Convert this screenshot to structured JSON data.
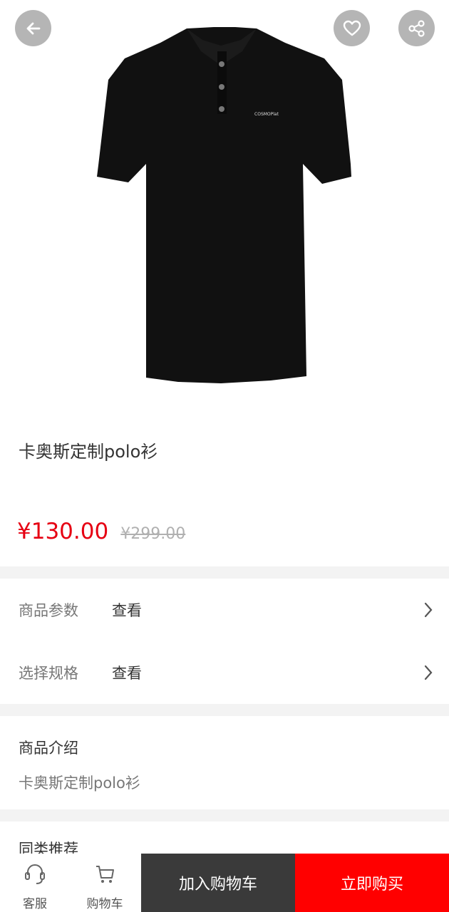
{
  "product": {
    "title": "卡奥斯定制polo衫",
    "price": "¥130.00",
    "original_price": "¥299.00",
    "logo_text": "COSMOPlat"
  },
  "specs": {
    "params_label": "商品参数",
    "params_value": "查看",
    "select_label": "选择规格",
    "select_value": "查看"
  },
  "intro": {
    "title": "商品介绍",
    "text": "卡奥斯定制polo衫"
  },
  "recommend": {
    "title": "同类推荐"
  },
  "bottom_bar": {
    "service_label": "客服",
    "cart_label": "购物车",
    "add_to_cart": "加入购物车",
    "buy_now": "立即购买"
  },
  "colors": {
    "price_red": "#e60012",
    "buy_button": "#ff0000",
    "cart_button": "#3a3a3a"
  },
  "icons": {
    "back": "arrow-left-icon",
    "favorite": "heart-icon",
    "share": "share-icon",
    "service": "headset-icon",
    "cart": "cart-icon",
    "chevron": "chevron-right-icon"
  }
}
